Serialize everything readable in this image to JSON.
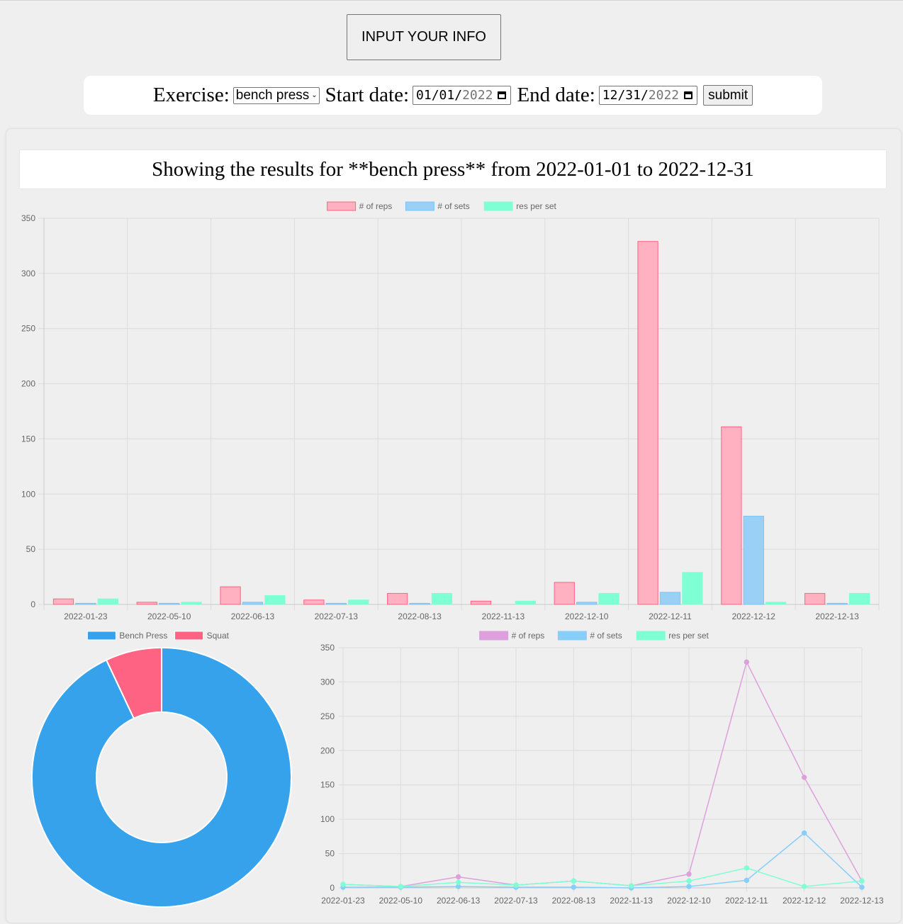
{
  "header": {
    "input_button_label": "INPUT YOUR INFO"
  },
  "form": {
    "exercise_label": "Exercise:",
    "exercise_value": "bench press",
    "start_label": "Start date:",
    "start_md": "01/01/",
    "start_year": "2022",
    "end_label": "End date:",
    "end_md": "12/31/",
    "end_year": "2022",
    "submit_label": "submit"
  },
  "results_title": "Showing the results for **bench press** from 2022-01-01 to 2022-12-31",
  "icons": {
    "dropdown": "chevron-down-icon",
    "calendar": "calendar-icon"
  },
  "chart_data": [
    {
      "type": "bar",
      "categories": [
        "2022-01-23",
        "2022-05-10",
        "2022-06-13",
        "2022-07-13",
        "2022-08-13",
        "2022-11-13",
        "2022-12-10",
        "2022-12-11",
        "2022-12-12",
        "2022-12-13"
      ],
      "series": [
        {
          "name": "# of reps",
          "values": [
            5,
            2,
            16,
            4,
            10,
            3,
            20,
            329,
            161,
            10
          ],
          "color": "#ffb1c1",
          "border": "#ff6384"
        },
        {
          "name": "# of sets",
          "values": [
            1,
            1,
            2,
            1,
            1,
            0,
            2,
            11,
            80,
            1
          ],
          "color": "#9ad0f5",
          "border": "#7cc4f4"
        },
        {
          "name": "res per set",
          "values": [
            5,
            2,
            8,
            4,
            10,
            3,
            10,
            29,
            2,
            10
          ],
          "color": "#7fffd4",
          "border": "#7fffd4"
        }
      ],
      "ylim": [
        0,
        350
      ],
      "yticks": [
        0,
        50,
        100,
        150,
        200,
        250,
        300,
        350
      ],
      "grid": true,
      "legend": "top"
    },
    {
      "type": "pie",
      "labels": [
        "Bench Press",
        "Squat"
      ],
      "values": [
        93,
        7
      ],
      "colors": [
        "#36a2eb",
        "#ff6384"
      ],
      "legend": "top"
    },
    {
      "type": "line",
      "categories": [
        "2022-01-23",
        "2022-05-10",
        "2022-06-13",
        "2022-07-13",
        "2022-08-13",
        "2022-11-13",
        "2022-12-10",
        "2022-12-11",
        "2022-12-12",
        "2022-12-13"
      ],
      "series": [
        {
          "name": "# of reps",
          "values": [
            5,
            2,
            16,
            4,
            10,
            3,
            20,
            329,
            161,
            10
          ],
          "color": "#dda0dd"
        },
        {
          "name": "# of sets",
          "values": [
            1,
            1,
            2,
            1,
            1,
            0,
            2,
            11,
            80,
            1
          ],
          "color": "#87cefa"
        },
        {
          "name": "res per set",
          "values": [
            5,
            2,
            8,
            4,
            10,
            3,
            10,
            29,
            2,
            10
          ],
          "color": "#7fffd4"
        }
      ],
      "ylim": [
        0,
        350
      ],
      "yticks": [
        0,
        50,
        100,
        150,
        200,
        250,
        300,
        350
      ],
      "grid": true,
      "legend": "top"
    }
  ]
}
